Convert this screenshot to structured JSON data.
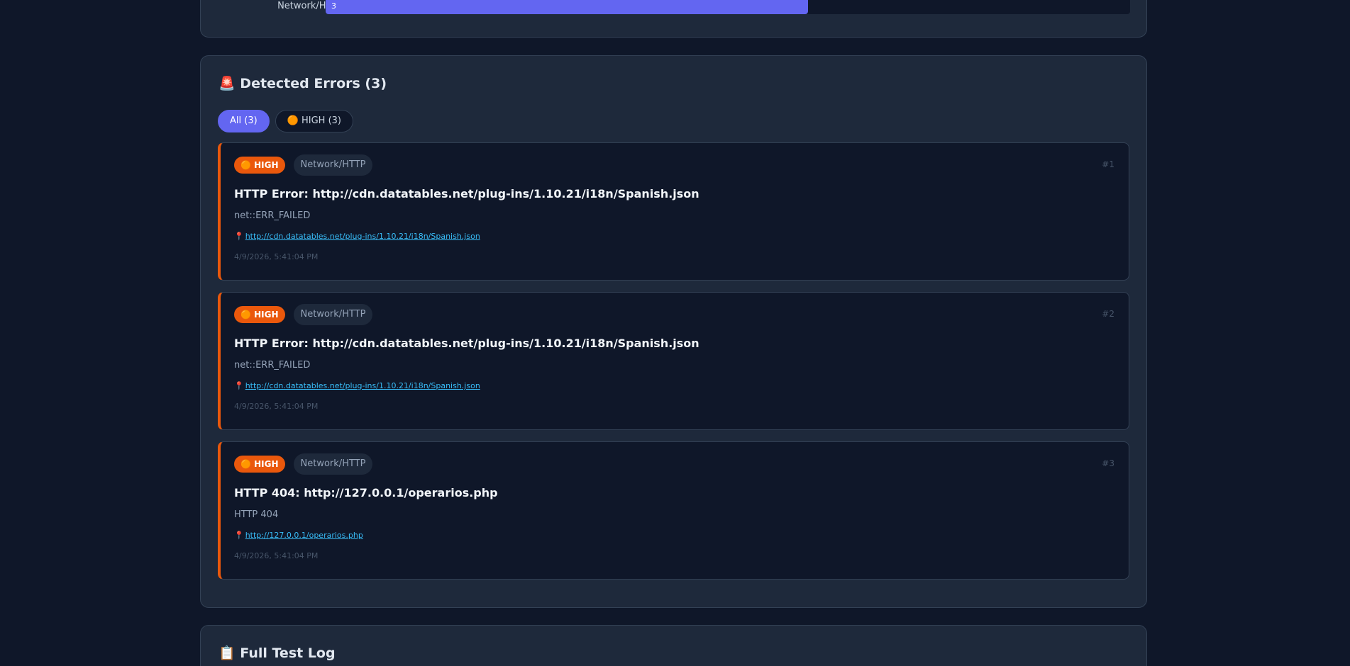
{
  "summary": {
    "bars": [
      {
        "label": "Network/HTTP",
        "value": "3",
        "fill_fraction": 0.6
      }
    ]
  },
  "errors_section": {
    "icon": "🚨",
    "title": "Detected Errors (3)",
    "filters": [
      {
        "label": "All (3)",
        "active": true
      },
      {
        "label": "🟠 HIGH (3)",
        "active": false
      }
    ],
    "errors": [
      {
        "severity": "🟠 HIGH",
        "category": "Network/HTTP",
        "index": "#1",
        "title": "HTTP Error: http://cdn.datatables.net/plug-ins/1.10.21/i18n/Spanish.json",
        "message": "net::ERR_FAILED",
        "location_icon": "📍",
        "location": "http://cdn.datatables.net/plug-ins/1.10.21/i18n/Spanish.json",
        "timestamp": "4/9/2026, 5:41:04 PM"
      },
      {
        "severity": "🟠 HIGH",
        "category": "Network/HTTP",
        "index": "#2",
        "title": "HTTP Error: http://cdn.datatables.net/plug-ins/1.10.21/i18n/Spanish.json",
        "message": "net::ERR_FAILED",
        "location_icon": "📍",
        "location": "http://cdn.datatables.net/plug-ins/1.10.21/i18n/Spanish.json",
        "timestamp": "4/9/2026, 5:41:04 PM"
      },
      {
        "severity": "🟠 HIGH",
        "category": "Network/HTTP",
        "index": "#3",
        "title": "HTTP 404: http://127.0.0.1/operarios.php",
        "message": "HTTP 404",
        "location_icon": "📍",
        "location": "http://127.0.0.1/operarios.php",
        "timestamp": "4/9/2026, 5:41:04 PM"
      }
    ]
  },
  "log_section": {
    "icon": "📋",
    "title": "Full Test Log"
  },
  "colors": {
    "background": "#0f1729",
    "panel": "#1e293b",
    "accent": "#6366f1",
    "severity_high": "#ea580c",
    "link": "#38bdf8"
  }
}
